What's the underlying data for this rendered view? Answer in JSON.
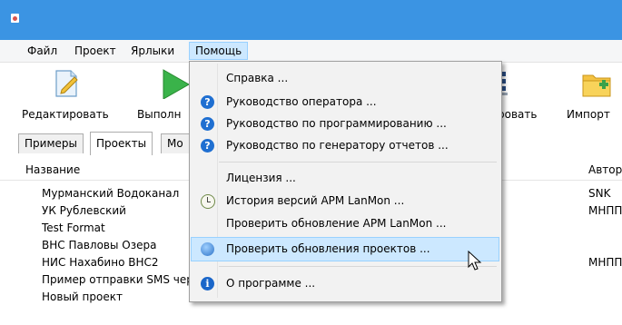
{
  "menubar": {
    "items": [
      {
        "label": "Файл"
      },
      {
        "label": "Проект"
      },
      {
        "label": "Ярлыки"
      },
      {
        "label": "Помощь"
      }
    ]
  },
  "toolbar": {
    "edit_label": "Редактировать",
    "run_label": "Выполн",
    "partial_label": "ровать",
    "import_label": "Импорт"
  },
  "tabs": [
    {
      "label": "Примеры"
    },
    {
      "label": "Проекты"
    },
    {
      "label": "Мо"
    }
  ],
  "list": {
    "header_name": "Название",
    "header_author": "Автор",
    "rows": [
      {
        "name": "Мурманский Водоканал",
        "author": "SNK"
      },
      {
        "name": "УК Рублевский",
        "author": "МНПП"
      },
      {
        "name": "Test Format",
        "author": ""
      },
      {
        "name": "ВНС Павловы Озера",
        "author": ""
      },
      {
        "name": "НИС Нахабино ВНС2",
        "author": "МНПП"
      },
      {
        "name": "Пример отправки SMS через интернет сервис smsc.ru",
        "author": ""
      },
      {
        "name": "Новый проект",
        "author": ""
      }
    ]
  },
  "help_menu": {
    "items": [
      {
        "label": "Справка ...",
        "icon": ""
      },
      {
        "label": "Руководство оператора ...",
        "icon": "question-icon"
      },
      {
        "label": "Руководство по программированию ...",
        "icon": "question-icon"
      },
      {
        "label": "Руководство по генератору отчетов ...",
        "icon": "question-icon"
      },
      {
        "label": "Лицензия ...",
        "icon": ""
      },
      {
        "label": "История версий АРМ LanMon ...",
        "icon": "clock-icon"
      },
      {
        "label": "Проверить обновление АРМ LanMon ...",
        "icon": ""
      },
      {
        "label": "Проверить обновления проектов ...",
        "icon": "globe-icon"
      },
      {
        "label": "О программе ...",
        "icon": "info-icon"
      }
    ]
  },
  "colors": {
    "titlebar": "#3b94e3",
    "menu_highlight": "#cce8ff",
    "menu_highlight_border": "#99d1ff"
  }
}
